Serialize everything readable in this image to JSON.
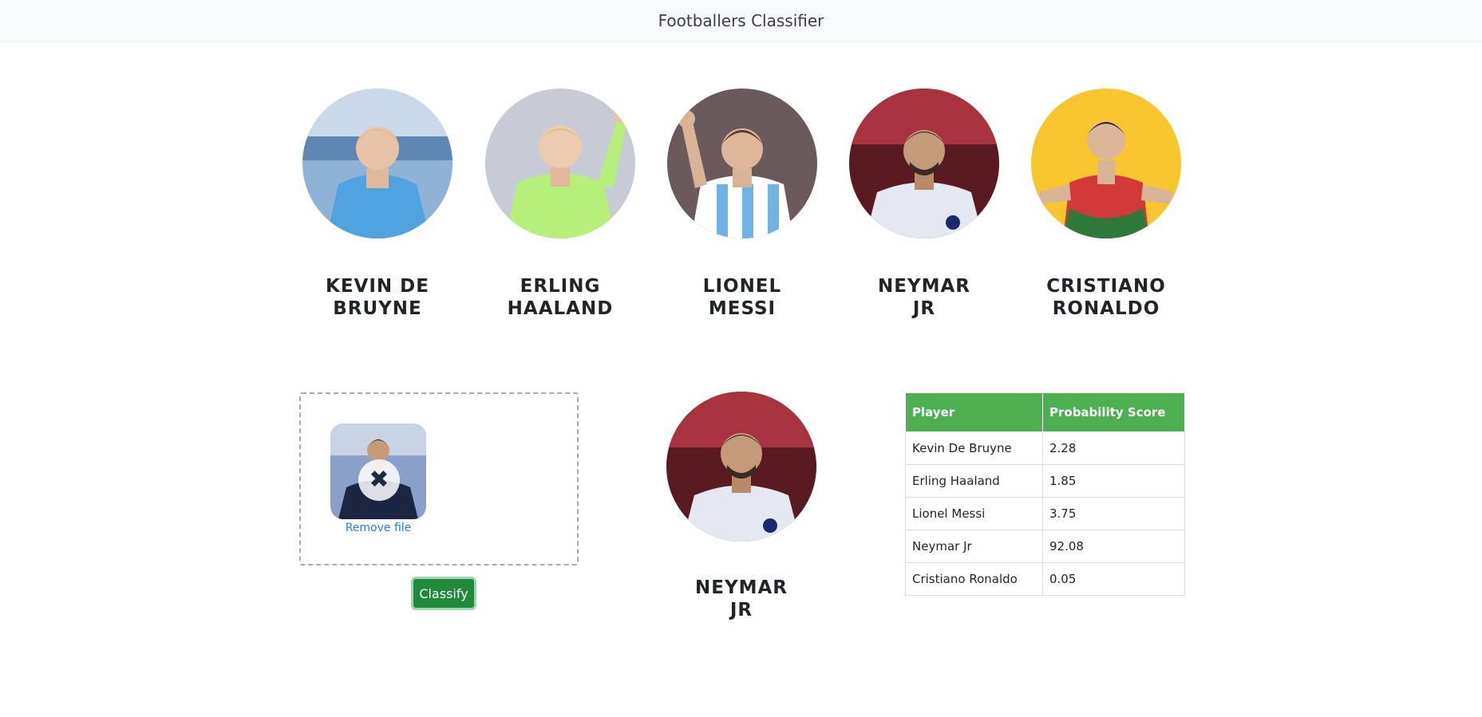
{
  "navbar": {
    "title": "Footballers Classifier"
  },
  "players": [
    {
      "name": "KEVIN DE BRUYNE",
      "icon": "kevin-de-bruyne-photo"
    },
    {
      "name": "ERLING HAALAND",
      "icon": "erling-haaland-photo"
    },
    {
      "name": "LIONEL MESSI",
      "icon": "lionel-messi-photo"
    },
    {
      "name": "NEYMAR JR",
      "icon": "neymar-jr-photo"
    },
    {
      "name": "CRISTIANO RONALDO",
      "icon": "cristiano-ronaldo-photo"
    }
  ],
  "upload": {
    "remove_label": "Remove file",
    "remove_icon": "close-icon"
  },
  "classify_label": "Classify",
  "result": {
    "name": "NEYMAR JR"
  },
  "table": {
    "headers": [
      "Player",
      "Probability Score"
    ],
    "rows": [
      [
        "Kevin De Bruyne",
        "2.28"
      ],
      [
        "Erling Haaland",
        "1.85"
      ],
      [
        "Lionel Messi",
        "3.75"
      ],
      [
        "Neymar Jr",
        "92.08"
      ],
      [
        "Cristiano Ronaldo",
        "0.05"
      ]
    ]
  },
  "colors": {
    "table_header": "#4caf50",
    "classify_button": "#1f8a3a",
    "link": "#2a7bd6"
  }
}
